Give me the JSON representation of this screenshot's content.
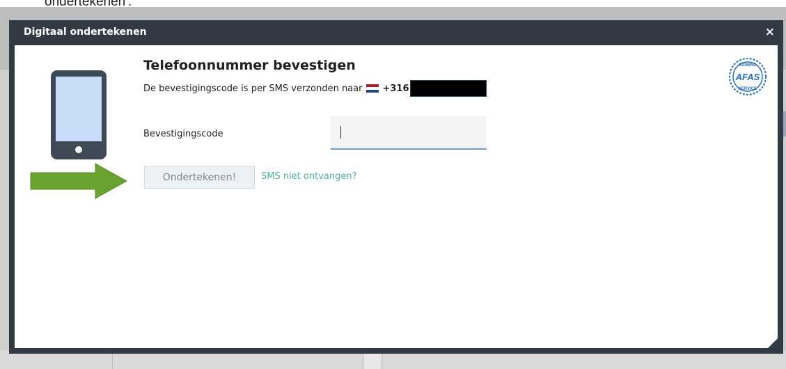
{
  "background": {
    "top_text": "ondertekenen'."
  },
  "modal": {
    "title": "Digitaal ondertekenen",
    "close_label": "×",
    "heading": "Telefoonnummer bevestigen",
    "subline_text": "De bevestigingscode is per SMS verzonden naar",
    "phone_prefix": "+316",
    "code_label": "Bevestigingscode",
    "code_value": "",
    "sign_button_label": "Ondertekenen!",
    "sms_link_label": "SMS niet ontvangen?",
    "badge_icon": "afas-signing-service-seal",
    "badge_text": "AFAS",
    "badge_ring_text": "SIGNING · SERVICE"
  },
  "colors": {
    "titlebar": "#323a44",
    "link": "#4fb0a1",
    "input_underline": "#6a9ec4",
    "arrow": "#6aa232",
    "phone_body": "#3e4a56",
    "phone_screen": "#c7dcf8",
    "flag_red": "#ae1c28",
    "flag_white": "#ffffff",
    "flag_blue": "#21468b",
    "badge_blue": "#2a6fb8"
  },
  "icons": {
    "phone": "smartphone-icon",
    "arrow": "green-arrow-icon",
    "flag": "netherlands-flag-icon"
  }
}
